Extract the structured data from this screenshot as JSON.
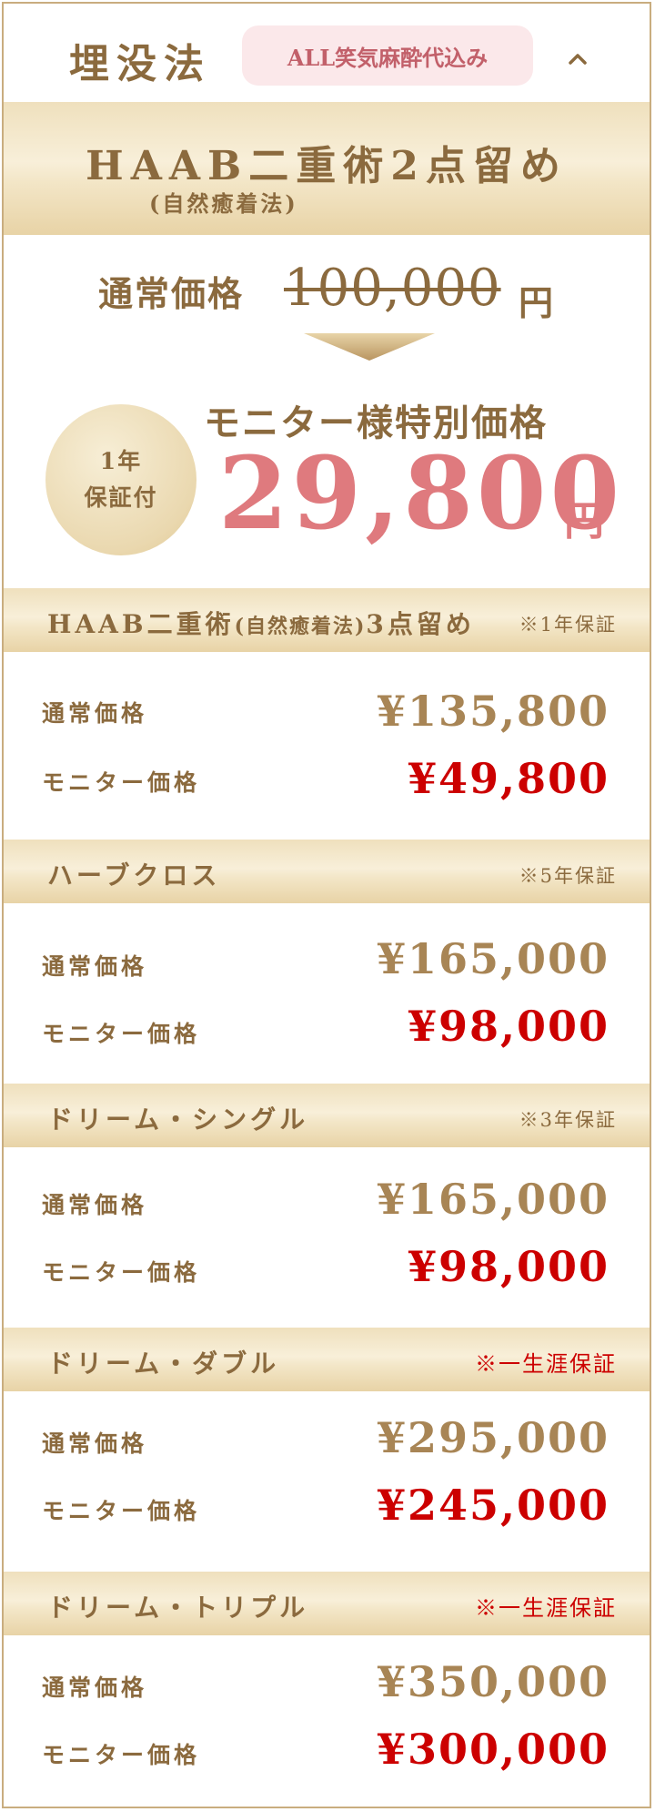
{
  "header": {
    "title": "埋没法",
    "badge": "ALL笑気麻酔代込み"
  },
  "hero": {
    "title": "HAAB二重術2点留め",
    "subtitle": "(自然癒着法)",
    "regular_label": "通常価格",
    "regular_price": "100,000",
    "regular_currency": "円",
    "warranty_line1": "1年",
    "warranty_line2": "保証付",
    "monitor_label": "モニター様特別価格",
    "monitor_price": "29,800",
    "monitor_currency": "円"
  },
  "plans": [
    {
      "name_main": "HAAB二重術",
      "name_paren": "(自然癒着法)",
      "name_tail": "3点留め",
      "warranty": "※1年保証",
      "warranty_red": false,
      "regular_label": "通常価格",
      "regular_price": "¥135,800",
      "monitor_label": "モニター価格",
      "monitor_price": "¥49,800"
    },
    {
      "name_main": "ハーブクロス",
      "name_paren": "",
      "name_tail": "",
      "warranty": "※5年保証",
      "warranty_red": false,
      "regular_label": "通常価格",
      "regular_price": "¥165,000",
      "monitor_label": "モニター価格",
      "monitor_price": "¥98,000"
    },
    {
      "name_main": "ドリーム・シングル",
      "name_paren": "",
      "name_tail": "",
      "warranty": "※3年保証",
      "warranty_red": false,
      "regular_label": "通常価格",
      "regular_price": "¥165,000",
      "monitor_label": "モニター価格",
      "monitor_price": "¥98,000"
    },
    {
      "name_main": "ドリーム・ダブル",
      "name_paren": "",
      "name_tail": "",
      "warranty": "※一生涯保証",
      "warranty_red": true,
      "regular_label": "通常価格",
      "regular_price": "¥295,000",
      "monitor_label": "モニター価格",
      "monitor_price": "¥245,000"
    },
    {
      "name_main": "ドリーム・トリプル",
      "name_paren": "",
      "name_tail": "",
      "warranty": "※一生涯保証",
      "warranty_red": true,
      "regular_label": "通常価格",
      "regular_price": "¥350,000",
      "monitor_label": "モニター価格",
      "monitor_price": "¥300,000"
    }
  ],
  "colors": {
    "gold_text": "#8b6a3e",
    "monitor_pink": "#df7a7e",
    "monitor_red": "#cc0000",
    "badge_bg": "#fbe8ea"
  }
}
